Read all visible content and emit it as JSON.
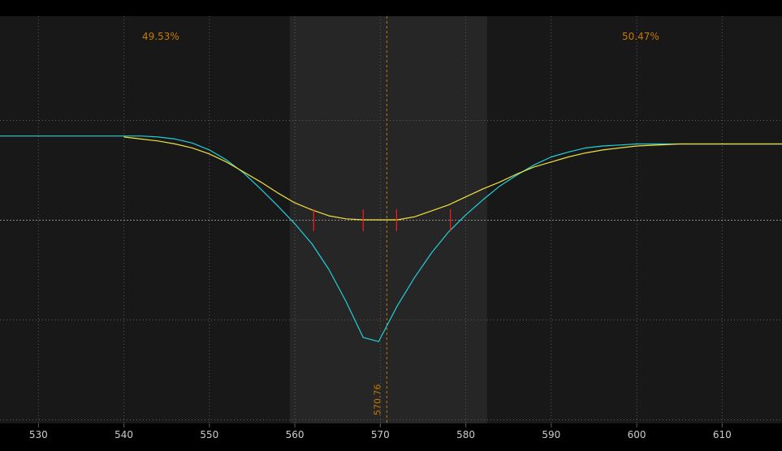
{
  "chart_data": {
    "type": "line",
    "title": "",
    "xlabel": "",
    "ylabel": "",
    "xlim": [
      525.5,
      617.0
    ],
    "ylim": [
      -2.1,
      1.0
    ],
    "x_ticks": [
      "530",
      "540",
      "550",
      "560",
      "570",
      "580",
      "590",
      "600",
      "610"
    ],
    "x_tick_values": [
      530,
      540,
      550,
      560,
      570,
      580,
      590,
      600,
      610
    ],
    "y_grid": [
      -2.0,
      -1.0,
      0.0,
      1.0
    ],
    "grid": true,
    "legend": "none",
    "highlight_band": [
      559.4,
      582.5
    ],
    "marker_line": {
      "value": 570.76,
      "label": "570.76"
    },
    "annotations": [
      {
        "text": "49.53%",
        "position": "top-left"
      },
      {
        "text": "50.47%",
        "position": "top-right"
      }
    ],
    "zero_line_ticks": [
      562.2,
      568.0,
      571.9,
      578.2
    ],
    "series": [
      {
        "color": "#22d0d8",
        "x": [
          525.5,
          540,
          542,
          544,
          546,
          548,
          550,
          552,
          554,
          556,
          558,
          560,
          562,
          564,
          566,
          568,
          569.8,
          572,
          574,
          576,
          578,
          580,
          582,
          584,
          586,
          588,
          590,
          592,
          594,
          596,
          598,
          600,
          605,
          610,
          617
        ],
        "y": [
          0.84,
          0.84,
          0.84,
          0.83,
          0.81,
          0.77,
          0.7,
          0.6,
          0.47,
          0.31,
          0.14,
          -0.04,
          -0.24,
          -0.5,
          -0.82,
          -1.18,
          -1.22,
          -0.86,
          -0.58,
          -0.33,
          -0.12,
          0.05,
          0.2,
          0.34,
          0.45,
          0.55,
          0.63,
          0.68,
          0.72,
          0.74,
          0.75,
          0.76,
          0.76,
          0.76,
          0.76
        ]
      },
      {
        "color": "#f0e040",
        "x": [
          540,
          542,
          544,
          546,
          548,
          550,
          552,
          554,
          556,
          558,
          560,
          562,
          564,
          566,
          568,
          570,
          572,
          574,
          576,
          578,
          580,
          582,
          584,
          586,
          588,
          590,
          592,
          594,
          596,
          598,
          600,
          605,
          610,
          617
        ],
        "y": [
          0.83,
          0.81,
          0.79,
          0.76,
          0.72,
          0.66,
          0.58,
          0.48,
          0.38,
          0.27,
          0.17,
          0.1,
          0.04,
          0.01,
          0.0,
          0.0,
          0.0,
          0.03,
          0.09,
          0.15,
          0.23,
          0.31,
          0.38,
          0.46,
          0.53,
          0.58,
          0.63,
          0.67,
          0.7,
          0.72,
          0.74,
          0.76,
          0.76,
          0.76
        ]
      }
    ],
    "colors": {
      "background": "#000000",
      "plot_background": "#181818",
      "band": "#262626",
      "grid": "#5a5a5a",
      "axis_text": "#cccccc",
      "accent": "#c87a00",
      "tick_marks": "#ff1a1a"
    }
  }
}
